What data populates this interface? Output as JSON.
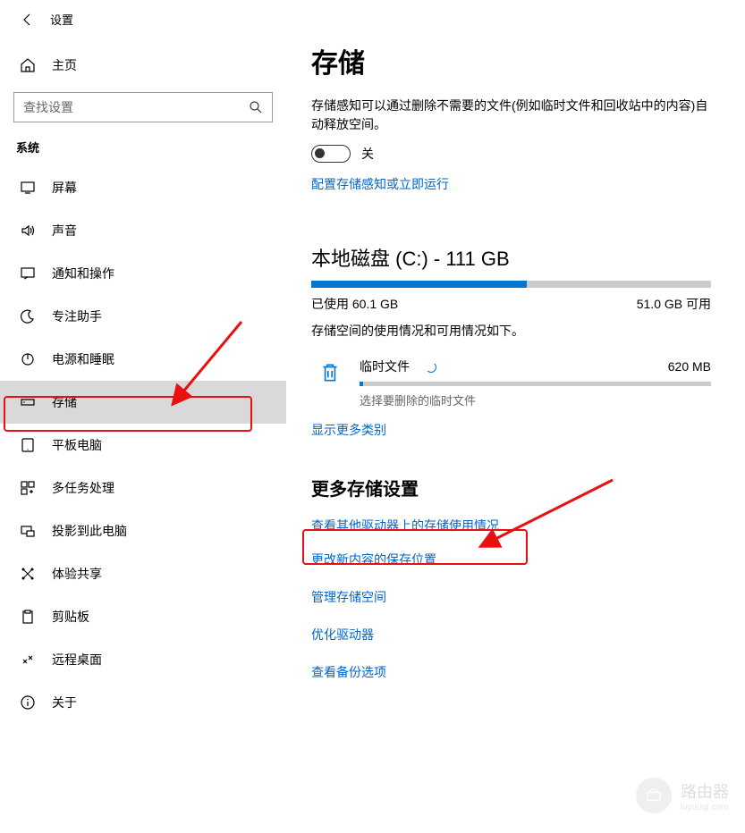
{
  "titlebar": {
    "title": "设置"
  },
  "home": {
    "label": "主页"
  },
  "search": {
    "placeholder": "查找设置"
  },
  "section_label": "系统",
  "nav": [
    {
      "label": "屏幕"
    },
    {
      "label": "声音"
    },
    {
      "label": "通知和操作"
    },
    {
      "label": "专注助手"
    },
    {
      "label": "电源和睡眠"
    },
    {
      "label": "存储"
    },
    {
      "label": "平板电脑"
    },
    {
      "label": "多任务处理"
    },
    {
      "label": "投影到此电脑"
    },
    {
      "label": "体验共享"
    },
    {
      "label": "剪贴板"
    },
    {
      "label": "远程桌面"
    },
    {
      "label": "关于"
    }
  ],
  "main": {
    "title": "存储",
    "desc": "存储感知可以通过删除不需要的文件(例如临时文件和回收站中的内容)自动释放空间。",
    "toggle_label": "关",
    "config_link": "配置存储感知或立即运行",
    "disk_title": "本地磁盘 (C:) - 111 GB",
    "used_label": "已使用 60.1 GB",
    "free_label": "51.0 GB 可用",
    "disk_desc": "存储空间的使用情况和可用情况如下。",
    "temp": {
      "title": "临时文件",
      "size": "620 MB",
      "sub": "选择要删除的临时文件"
    },
    "more_categories": "显示更多类别",
    "more_heading": "更多存储设置",
    "links": [
      "查看其他驱动器上的存储使用情况",
      "更改新内容的保存位置",
      "管理存储空间",
      "优化驱动器",
      "查看备份选项"
    ]
  },
  "watermark": {
    "text": "路由器",
    "sub": "luyouqi.com"
  }
}
